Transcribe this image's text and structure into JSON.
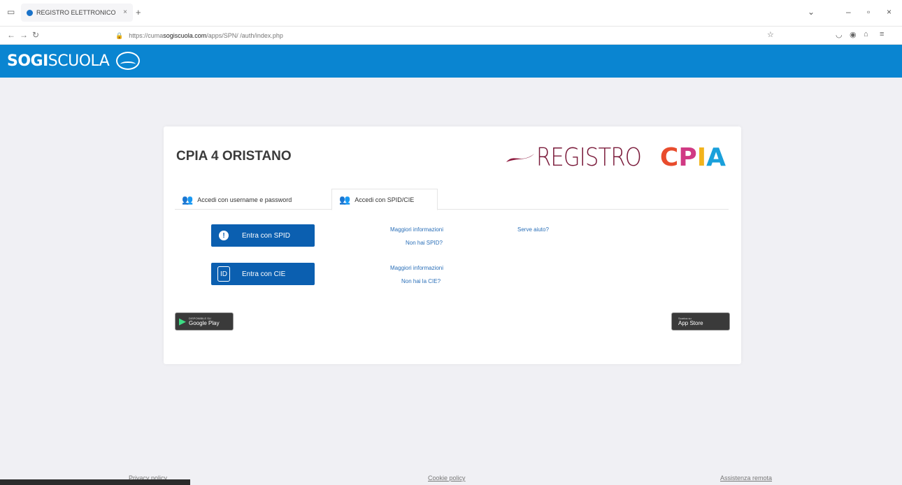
{
  "browser": {
    "tab_title": "REGISTRO ELETTRONICO",
    "url_prefix": "https://cuma",
    "url_host": "sogiscuola.com",
    "url_path": "/apps/SPN/ /auth/index.php"
  },
  "site": {
    "brand_bold": "SOGI",
    "brand_light": "SCUOLA",
    "header_color": "#0a85d1"
  },
  "card": {
    "school_name": "CPIA 4 ORISTANO",
    "logo_reg": "REGISTRO",
    "logo_c": "C",
    "logo_p": "P",
    "logo_i": "I",
    "logo_a": "A",
    "tab_user_pass": "Accedi con username e password",
    "tab_spid_cie": "Accedi con SPID/CIE",
    "spid_button": "Entra con SPID",
    "cie_button": "Entra con CIE",
    "spid_more_info": "Maggiori informazioni",
    "spid_no": "Non hai SPID?",
    "cie_more_info": "Maggiori informazioni",
    "cie_no": "Non hai la CIE?",
    "help": "Serve aiuto?",
    "google_play_small": "DISPONIBILE SU",
    "google_play": "Google Play",
    "app_store_small": "Scarica su",
    "app_store": "App Store"
  },
  "footer": {
    "privacy": "Privacy policy",
    "cookie": "Cookie policy",
    "assistance": "Assistenza remota"
  }
}
